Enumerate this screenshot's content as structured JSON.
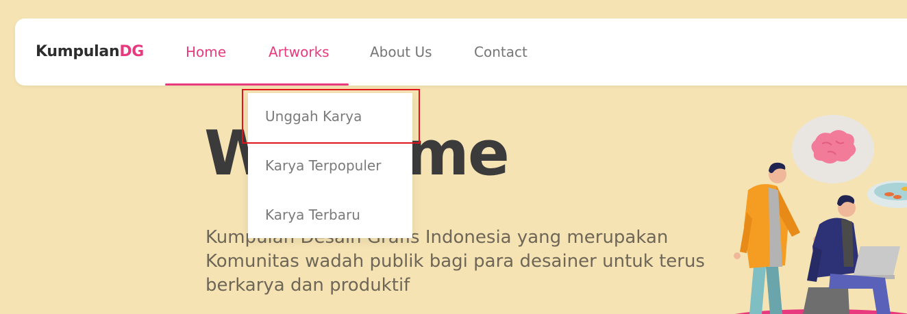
{
  "brand": {
    "name_main": "Kumpulan",
    "name_accent": "DG"
  },
  "nav": {
    "items": [
      {
        "label": "Home",
        "state": "active"
      },
      {
        "label": "Artworks",
        "state": "active"
      },
      {
        "label": "About Us",
        "state": "normal"
      },
      {
        "label": "Contact",
        "state": "normal"
      }
    ]
  },
  "dropdown": {
    "items": [
      {
        "label": "Unggah Karya"
      },
      {
        "label": "Karya Terpopuler"
      },
      {
        "label": "Karya Terbaru"
      }
    ],
    "highlighted_index": 0
  },
  "hero": {
    "title": "Welcome",
    "description": "Kumpulan Desain Grafis Indonesia yang merupakan Komunitas wadah publik bagi para desainer untuk terus berkarya dan produktif"
  },
  "colors": {
    "background": "#f5e3b3",
    "accent": "#e8397e",
    "text_dark": "#3b3b3b",
    "text_muted": "#757575",
    "highlight": "#e0151b"
  },
  "icons": {
    "illustration": "people-brainstorm-illustration"
  }
}
